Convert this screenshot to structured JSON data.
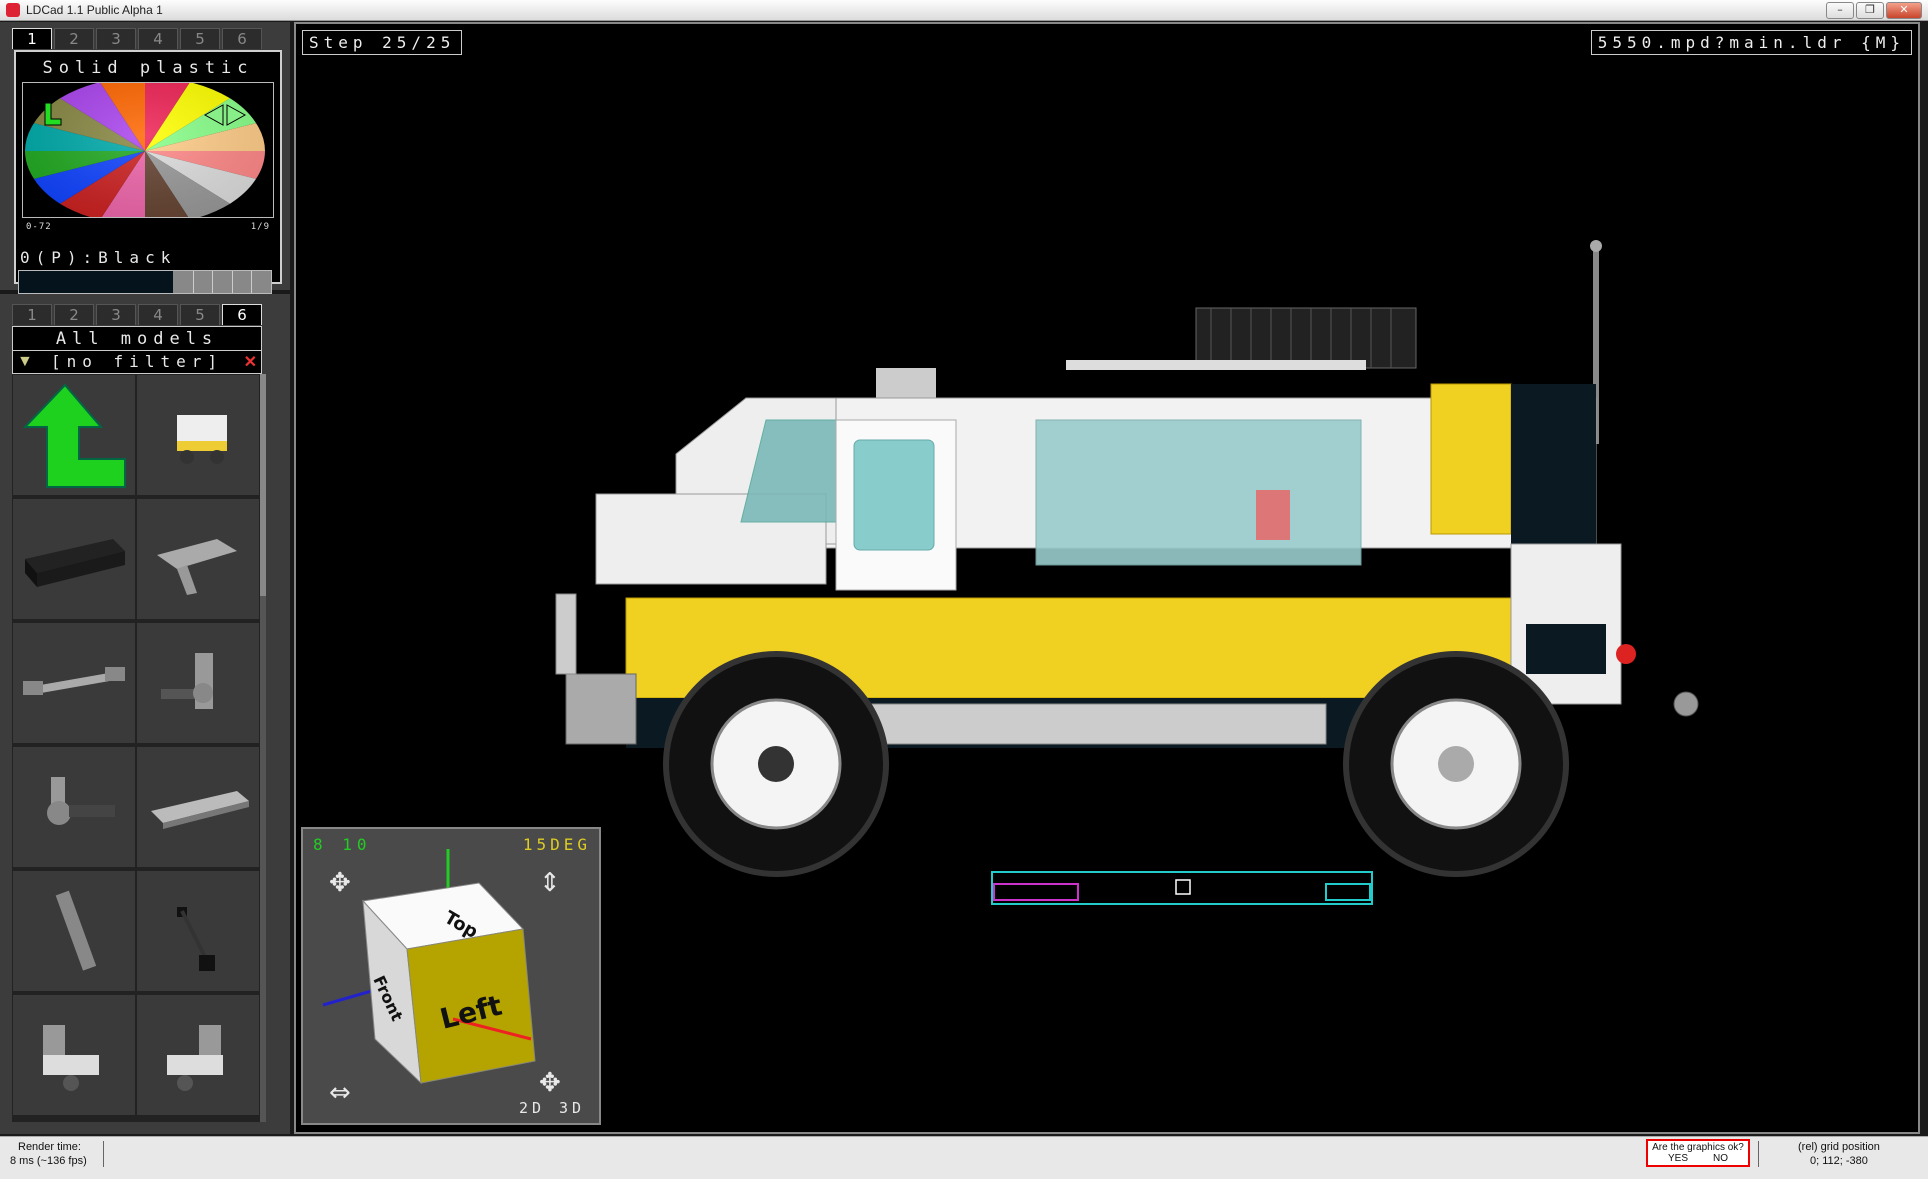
{
  "window": {
    "title": "LDCad 1.1 Public Alpha 1",
    "buttons": {
      "minimize": "–",
      "restore": "❐",
      "close": "✕"
    }
  },
  "color_panel": {
    "tabs": [
      "1",
      "2",
      "3",
      "4",
      "5",
      "6"
    ],
    "active_tab": "1",
    "header": "Solid plastic",
    "wheel_range": "0-72",
    "wheel_page": "1/9",
    "selected_color": "0(P):Black",
    "colors": {
      "black": "#05131D",
      "accent_green": "#22dd22"
    }
  },
  "parts_panel": {
    "tabs": [
      "1",
      "2",
      "3",
      "4",
      "5",
      "6"
    ],
    "active_tab": "6",
    "header": "All models",
    "filter": "[no filter]",
    "items": [
      "up-arrow",
      "vehicle-model",
      "brick-1x4-black",
      "plate-grey",
      "lever-bar",
      "robot-arm",
      "hose-joint",
      "spoiler-plate",
      "ribbed-hose",
      "antenna-arm",
      "bracket-joint-a",
      "bracket-joint-b"
    ]
  },
  "viewport": {
    "step": "Step 25/25",
    "file": "5550.mpd?main.ldr {M}",
    "navcube": {
      "grid": "8 10",
      "angle": "15DEG",
      "mode_2d": "2D",
      "mode_3d": "3D",
      "face_top": "Top",
      "face_front": "Front",
      "face_left": "Left"
    }
  },
  "statusbar": {
    "render_label": "Render time:",
    "render_value": "8 ms (~136 fps)",
    "graphics_question": "Are the graphics ok?",
    "graphics_yes": "YES",
    "graphics_no": "NO",
    "grid_label": "(rel) grid position",
    "grid_value": "0; 112; -380"
  }
}
